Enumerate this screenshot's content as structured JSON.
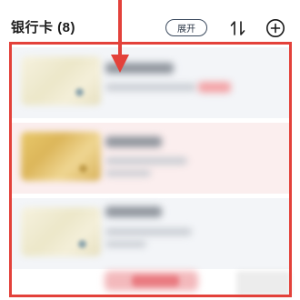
{
  "header": {
    "title": "银行卡 (8)",
    "expand_label": "展开",
    "sort_icon": "sort-icon",
    "add_icon": "add-circle-icon"
  },
  "annotation": {
    "box_color": "#e3413a",
    "arrow_color": "#e3413a"
  },
  "cards": [
    {
      "style": "light"
    },
    {
      "style": "gold"
    },
    {
      "style": "light"
    }
  ],
  "colors": {
    "row_gray": "#f3f5f8",
    "row_pink": "#fbeeee",
    "button_border": "#3b4a5e"
  }
}
